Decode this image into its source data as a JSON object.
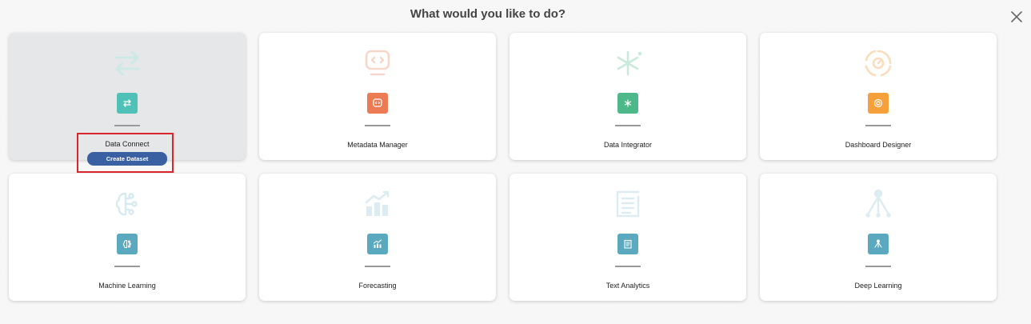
{
  "dialog": {
    "title": "What would you like to do?",
    "close_icon": "close-icon"
  },
  "cards": [
    {
      "label": "Data Connect",
      "icon": "arrows-exchange-icon",
      "color": "#4fc1b6",
      "active": true,
      "action": "Create Dataset"
    },
    {
      "label": "Metadata Manager",
      "icon": "monitor-code-icon",
      "color": "#ec7a52"
    },
    {
      "label": "Data Integrator",
      "icon": "asterisk-icon",
      "color": "#4db88a"
    },
    {
      "label": "Dashboard Designer",
      "icon": "target-icon",
      "color": "#f5a03a"
    },
    {
      "label": "Machine Learning",
      "icon": "brain-circuit-icon",
      "color": "#5aa9bf"
    },
    {
      "label": "Forecasting",
      "icon": "chart-trend-icon",
      "color": "#5aa9bf"
    },
    {
      "label": "Text Analytics",
      "icon": "document-text-icon",
      "color": "#5aa9bf"
    },
    {
      "label": "Deep Learning",
      "icon": "network-tree-icon",
      "color": "#5aa9bf"
    }
  ],
  "highlight_color": "#d9262c",
  "button_color": "#3a5fa3"
}
